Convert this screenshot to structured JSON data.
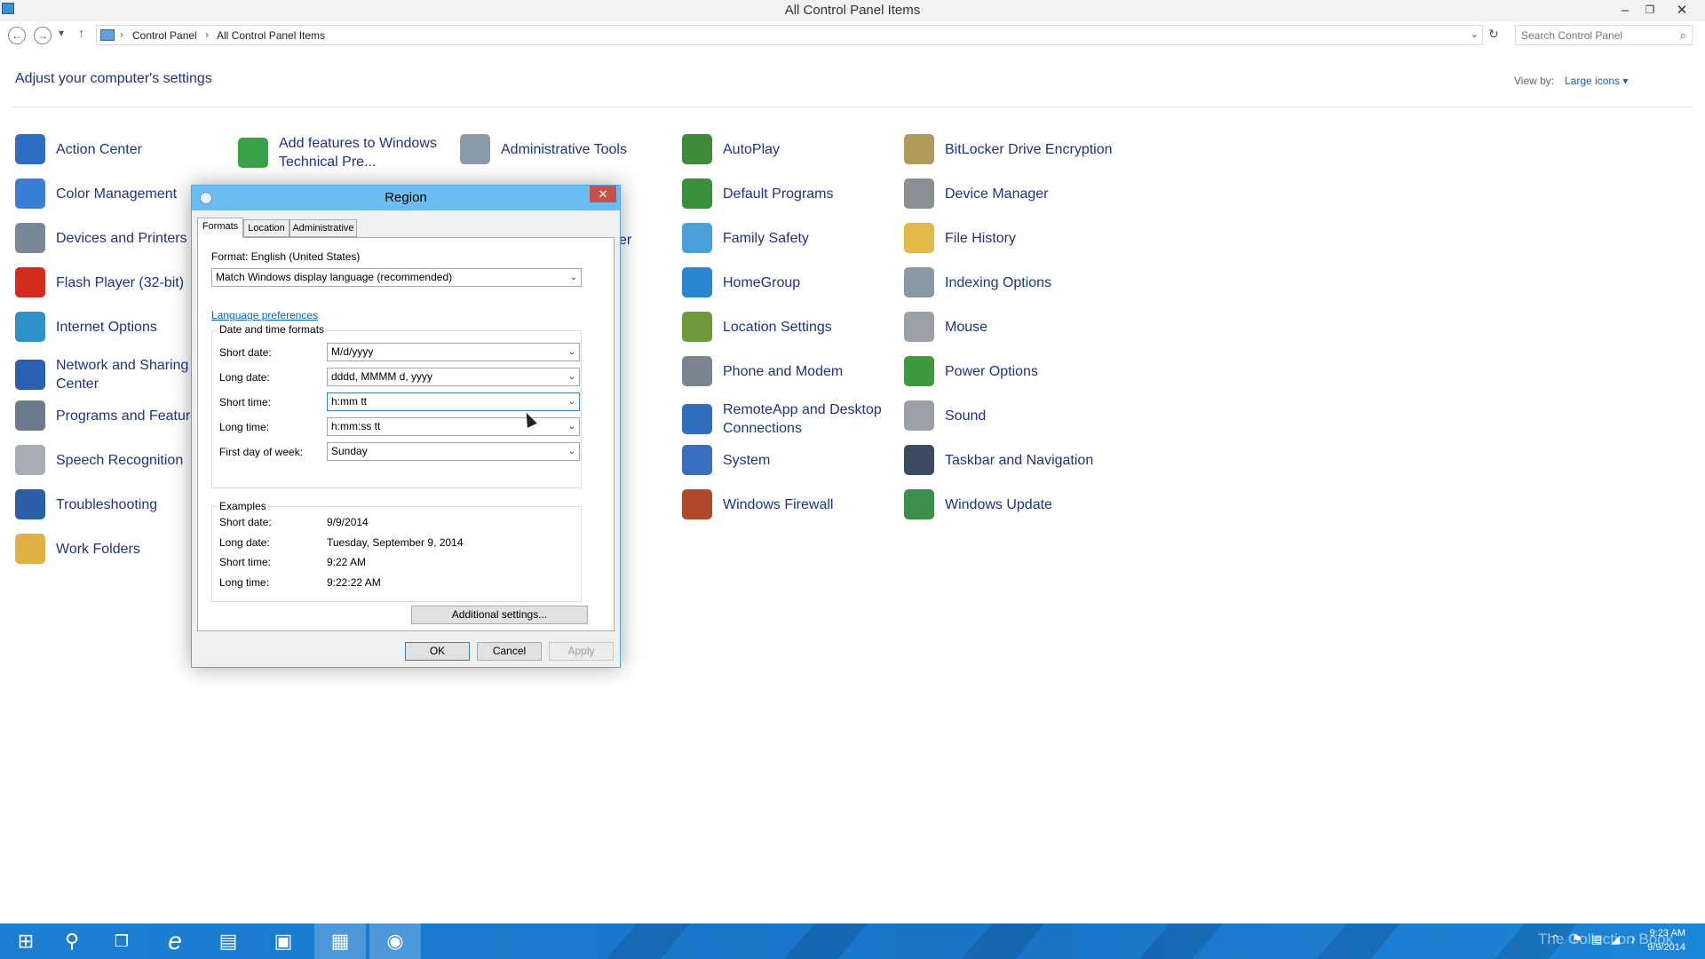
{
  "window": {
    "title": "All Control Panel Items",
    "minimize": "–",
    "restore": "❐",
    "close": "✕"
  },
  "nav": {
    "back": "←",
    "forward": "→",
    "history": "▾",
    "up": "↑",
    "refresh": "↻"
  },
  "breadcrumb": {
    "items": [
      "Control Panel",
      "All Control Panel Items"
    ],
    "sep": "›",
    "dropdown": "⌄"
  },
  "search": {
    "placeholder": "Search Control Panel",
    "icon": "⌕"
  },
  "heading": "Adjust your computer's settings",
  "view_by": {
    "label": "View by:",
    "value": "Large icons ▾"
  },
  "items": [
    {
      "label": "Action Center",
      "color": "#2e6fc4"
    },
    {
      "label": "Add features to Windows Technical Pre...",
      "color": "#39a14a"
    },
    {
      "label": "Administrative Tools",
      "color": "#8a9aa8"
    },
    {
      "label": "AutoPlay",
      "color": "#3f8a3c"
    },
    {
      "label": "BitLocker Drive Encryption",
      "color": "#b09a5a"
    },
    {
      "label": "Color Management",
      "color": "#3a7fd6"
    },
    {
      "label": "Default Programs",
      "color": "#3a8f3a"
    },
    {
      "label": "Device Manager",
      "color": "#8a8f96"
    },
    {
      "label": "Devices and Printers",
      "color": "#7a8796"
    },
    {
      "label": "Family Safety",
      "color": "#4aa0d8"
    },
    {
      "label": "File History",
      "color": "#e3b94a"
    },
    {
      "label": "Flash Player (32-bit)",
      "color": "#d42b1f"
    },
    {
      "label": "HomeGroup",
      "color": "#2b86d1"
    },
    {
      "label": "Indexing Options",
      "color": "#8a98a6"
    },
    {
      "label": "Internet Options",
      "color": "#2f8fc9"
    },
    {
      "label": "Location Settings",
      "color": "#6f9a3c"
    },
    {
      "label": "Mouse",
      "color": "#9aa1a8"
    },
    {
      "label": "Network and Sharing Center",
      "color": "#2b5fb0"
    },
    {
      "label": "Phone and Modem",
      "color": "#7b8590"
    },
    {
      "label": "Power Options",
      "color": "#3f9a3f"
    },
    {
      "label": "Programs and Features",
      "color": "#6a7a8c"
    },
    {
      "label": "RemoteApp and Desktop Connections",
      "color": "#2f6fbd"
    },
    {
      "label": "Sound",
      "color": "#9aa0a6"
    },
    {
      "label": "Speech Recognition",
      "color": "#a8adb3"
    },
    {
      "label": "System",
      "color": "#3a6fc0"
    },
    {
      "label": "Taskbar and Navigation",
      "color": "#3c4c60"
    },
    {
      "label": "Troubleshooting",
      "color": "#2b5fa8"
    },
    {
      "label": "Windows Firewall",
      "color": "#b04a2f"
    },
    {
      "label": "Windows Update",
      "color": "#3b8f4a"
    },
    {
      "label": "Work Folders",
      "color": "#e0b246"
    }
  ],
  "partial_behind_dialog": "er",
  "dialog": {
    "title": "Region",
    "close": "✕",
    "tabs": [
      "Formats",
      "Location",
      "Administrative"
    ],
    "format_label": "Format: English (United States)",
    "format_value": "Match Windows display language (recommended)",
    "language_link": "Language preferences",
    "dt_group_title": "Date and time formats",
    "fields": [
      {
        "label": "Short date:",
        "value": "M/d/yyyy"
      },
      {
        "label": "Long date:",
        "value": "dddd, MMMM d, yyyy"
      },
      {
        "label": "Short time:",
        "value": "h:mm tt"
      },
      {
        "label": "Long time:",
        "value": "h:mm:ss tt"
      },
      {
        "label": "First day of week:",
        "value": "Sunday"
      }
    ],
    "examples_title": "Examples",
    "examples": [
      {
        "label": "Short date:",
        "value": "9/9/2014"
      },
      {
        "label": "Long date:",
        "value": "Tuesday, September 9, 2014"
      },
      {
        "label": "Short time:",
        "value": "9:22 AM"
      },
      {
        "label": "Long time:",
        "value": "9:22:22 AM"
      }
    ],
    "additional_settings": "Additional settings...",
    "ok": "OK",
    "cancel": "Cancel",
    "apply": "Apply",
    "arrow": "⌄"
  },
  "taskbar": {
    "start": "⊞",
    "search": "⚲",
    "taskview": "❐",
    "ie": "e",
    "explorer": "▤",
    "store": "▣",
    "controlpanel": "▦",
    "region": "◉",
    "watermark": "The Collection Book",
    "tray_icons": [
      "⌃",
      "⚑",
      "▤",
      "◢",
      "♪"
    ],
    "time": "9:23 AM",
    "date": "9/9/2014"
  }
}
